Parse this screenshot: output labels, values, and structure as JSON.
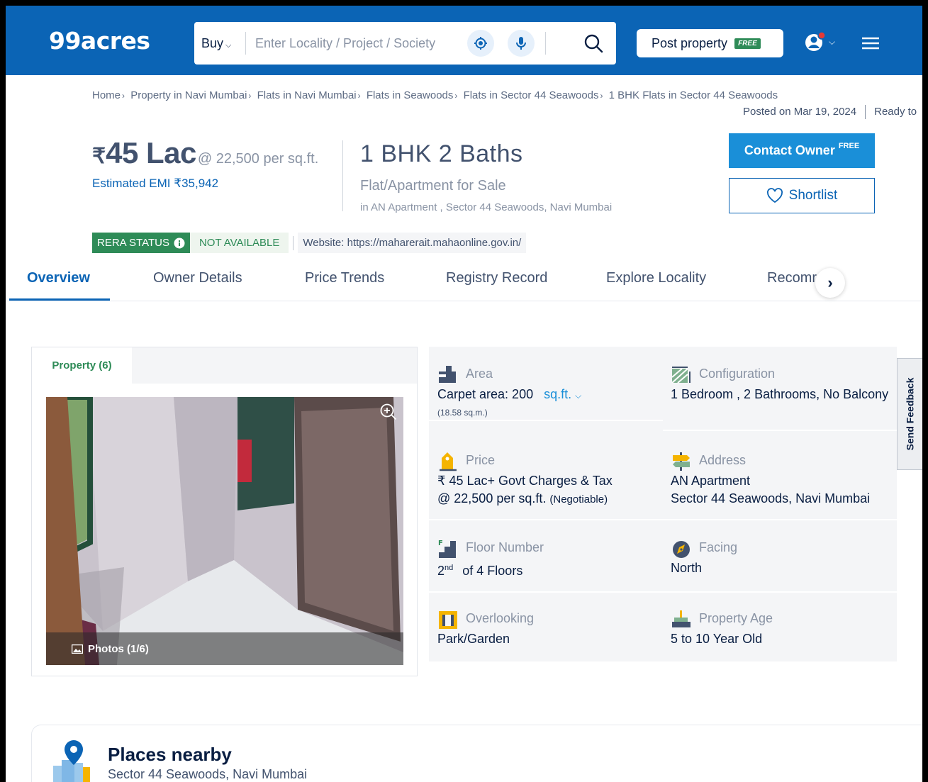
{
  "header": {
    "logo": "99acres",
    "buy_label": "Buy",
    "search_placeholder": "Enter Locality / Project / Society",
    "post_property_label": "Post property",
    "free_badge": "FREE"
  },
  "breadcrumb": [
    "Home",
    "Property in Navi Mumbai",
    "Flats in Navi Mumbai",
    "Flats in Seawoods",
    "Flats in Sector 44 Seawoods",
    "1 BHK Flats in Sector 44 Seawoods"
  ],
  "posted_on": "Posted on Mar 19, 2024",
  "possession_status": "Ready to",
  "listing": {
    "currency_symbol": "₹",
    "price": "45 Lac",
    "price_per_sqft": "@ 22,500 per sq.ft.",
    "emi": "Estimated EMI ₹35,942",
    "configuration_title": "1 BHK 2 Baths",
    "property_type": "Flat/Apartment for Sale",
    "location": "in AN Apartment , Sector 44 Seawoods, Navi Mumbai"
  },
  "actions": {
    "contact_owner": "Contact Owner",
    "contact_free": "FREE",
    "shortlist": "Shortlist"
  },
  "rera": {
    "status_label": "RERA STATUS",
    "status_value": "NOT AVAILABLE",
    "website": "Website: https://maharerait.mahaonline.gov.in/"
  },
  "tabs": [
    "Overview",
    "Owner Details",
    "Price Trends",
    "Registry Record",
    "Explore Locality",
    "Recomr"
  ],
  "gallery": {
    "tab_label": "Property (6)",
    "photos_caption": "Photos (1/6)"
  },
  "details": {
    "area": {
      "label": "Area",
      "value": "Carpet area: 200",
      "unit": "sq.ft.",
      "sub": "(18.58 sq.m.)"
    },
    "configuration": {
      "label": "Configuration",
      "value": "1 Bedroom , 2 Bathrooms, No Balcony"
    },
    "price": {
      "label": "Price",
      "line1": "₹ 45 Lac+ Govt Charges & Tax",
      "line2": "@ 22,500 per sq.ft.",
      "negotiable": "(Negotiable)"
    },
    "address": {
      "label": "Address",
      "line1": "AN Apartment",
      "line2": "Sector 44 Seawoods, Navi Mumbai"
    },
    "floor": {
      "label": "Floor Number",
      "floor_num": "2",
      "floor_suffix": "nd",
      "floor_total": "of 4 Floors"
    },
    "facing": {
      "label": "Facing",
      "value": "North"
    },
    "overlooking": {
      "label": "Overlooking",
      "value": "Park/Garden"
    },
    "property_age": {
      "label": "Property Age",
      "value": "5 to 10 Year Old"
    }
  },
  "feedback_label": "Send Feedback",
  "places_nearby": {
    "title": "Places nearby",
    "subtitle": "Sector 44 Seawoods, Navi Mumbai"
  },
  "colors": {
    "brand_blue": "#0b64b5",
    "contact_blue": "#1a8fd8",
    "rera_green": "#2e8b57"
  }
}
